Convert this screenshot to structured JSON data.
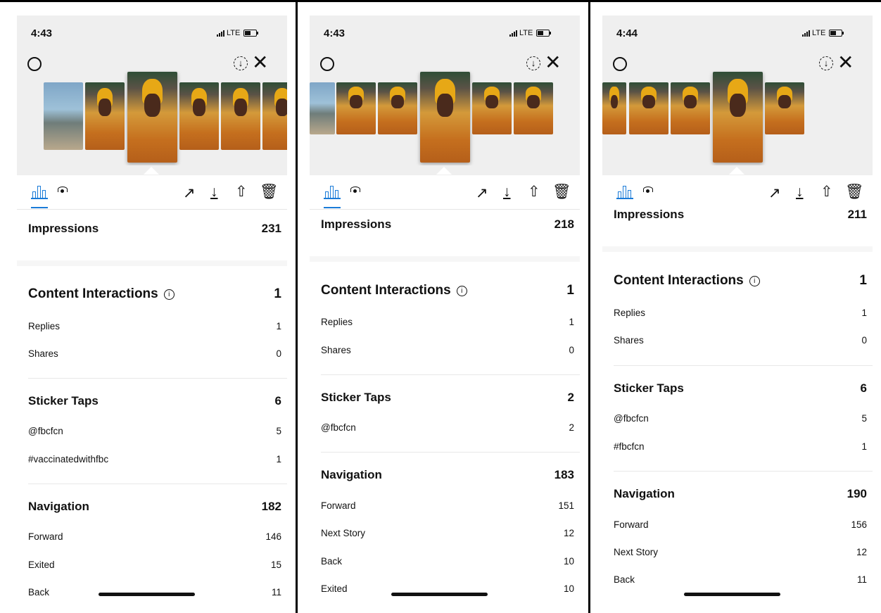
{
  "colors": {
    "accent": "#1a7bd8",
    "header_bg": "#efefef"
  },
  "panels": [
    {
      "status_time": "4:43",
      "carrier": "LTE",
      "icons": {
        "settings": "gear-icon",
        "save": "download-circle-icon",
        "close": "close-icon",
        "insights": "bar-chart-icon",
        "viewers": "eye-icon",
        "promote": "trend-up-icon",
        "download": "download-icon",
        "share": "share-icon",
        "delete": "trash-icon"
      },
      "impressions": {
        "label": "Impressions",
        "value": "231"
      },
      "content_interactions": {
        "label": "Content Interactions",
        "info": "i",
        "value": "1",
        "items": [
          {
            "label": "Replies",
            "value": "1"
          },
          {
            "label": "Shares",
            "value": "0"
          }
        ]
      },
      "sticker_taps": {
        "label": "Sticker Taps",
        "value": "6",
        "items": [
          {
            "label": "@fbcfcn",
            "value": "5"
          },
          {
            "label": "#vaccinatedwithfbc",
            "value": "1"
          }
        ]
      },
      "navigation": {
        "label": "Navigation",
        "value": "182",
        "items": [
          {
            "label": "Forward",
            "value": "146"
          },
          {
            "label": "Exited",
            "value": "15"
          },
          {
            "label": "Back",
            "value": "11"
          }
        ]
      }
    },
    {
      "status_time": "4:43",
      "carrier": "LTE",
      "icons": {
        "settings": "gear-icon",
        "save": "download-circle-icon",
        "close": "close-icon",
        "insights": "bar-chart-icon",
        "viewers": "eye-icon",
        "promote": "trend-up-icon",
        "download": "download-icon",
        "share": "share-icon",
        "delete": "trash-icon"
      },
      "impressions": {
        "label": "Impressions",
        "value": "218"
      },
      "content_interactions": {
        "label": "Content Interactions",
        "info": "i",
        "value": "1",
        "items": [
          {
            "label": "Replies",
            "value": "1"
          },
          {
            "label": "Shares",
            "value": "0"
          }
        ]
      },
      "sticker_taps": {
        "label": "Sticker Taps",
        "value": "2",
        "items": [
          {
            "label": "@fbcfcn",
            "value": "2"
          }
        ]
      },
      "navigation": {
        "label": "Navigation",
        "value": "183",
        "items": [
          {
            "label": "Forward",
            "value": "151"
          },
          {
            "label": "Next Story",
            "value": "12"
          },
          {
            "label": "Back",
            "value": "10"
          },
          {
            "label": "Exited",
            "value": "10"
          }
        ]
      }
    },
    {
      "status_time": "4:44",
      "carrier": "LTE",
      "icons": {
        "settings": "gear-icon",
        "save": "download-circle-icon",
        "close": "close-icon",
        "insights": "bar-chart-icon",
        "viewers": "eye-icon",
        "promote": "trend-up-icon",
        "download": "download-icon",
        "share": "share-icon",
        "delete": "trash-icon"
      },
      "impressions": {
        "label": "Impressions",
        "value": "211"
      },
      "content_interactions": {
        "label": "Content Interactions",
        "info": "i",
        "value": "1",
        "items": [
          {
            "label": "Replies",
            "value": "1"
          },
          {
            "label": "Shares",
            "value": "0"
          }
        ]
      },
      "sticker_taps": {
        "label": "Sticker Taps",
        "value": "6",
        "items": [
          {
            "label": "@fbcfcn",
            "value": "5"
          },
          {
            "label": "#fbcfcn",
            "value": "1"
          }
        ]
      },
      "navigation": {
        "label": "Navigation",
        "value": "190",
        "items": [
          {
            "label": "Forward",
            "value": "156"
          },
          {
            "label": "Next Story",
            "value": "12"
          },
          {
            "label": "Back",
            "value": "11"
          }
        ]
      }
    }
  ]
}
